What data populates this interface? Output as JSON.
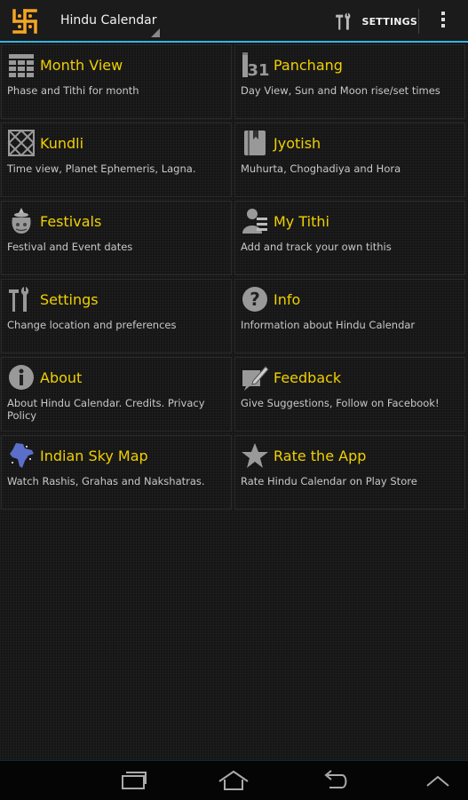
{
  "actionbar": {
    "title": "Hindu Calendar",
    "settings_label": "SETTINGS",
    "accent": "#33b5e5"
  },
  "menu": [
    {
      "title": "Month View",
      "desc": "Phase and Tithi for month",
      "icon": "calendar-grid-icon"
    },
    {
      "title": "Panchang",
      "desc": "Day View, Sun and Moon rise/set times",
      "icon": "calendar-31-icon",
      "icon_text": "31"
    },
    {
      "title": "Kundli",
      "desc": "Time view, Planet Ephemeris, Lagna.",
      "icon": "kundli-chart-icon"
    },
    {
      "title": "Jyotish",
      "desc": "Muhurta, Choghadiya and Hora",
      "icon": "book-icon"
    },
    {
      "title": "Festivals",
      "desc": "Festival and Event dates",
      "icon": "festival-pot-icon"
    },
    {
      "title": "My Tithi",
      "desc": "Add and track your own tithis",
      "icon": "person-list-icon"
    },
    {
      "title": "Settings",
      "desc": "Change location and preferences",
      "icon": "tools-icon"
    },
    {
      "title": "Info",
      "desc": "Information about Hindu Calendar",
      "icon": "question-icon"
    },
    {
      "title": "About",
      "desc": "About Hindu Calendar. Credits. Privacy Policy",
      "icon": "info-icon"
    },
    {
      "title": "Feedback",
      "desc": "Give Suggestions, Follow on Facebook!",
      "icon": "feedback-icon"
    },
    {
      "title": "Indian Sky Map",
      "desc": "Watch Rashis, Grahas and Nakshatras.",
      "icon": "india-map-icon"
    },
    {
      "title": "Rate the App",
      "desc": "Rate Hindu Calendar on Play Store",
      "icon": "star-icon"
    }
  ],
  "colors": {
    "title": "#f0d000",
    "logo": "#f5a623"
  }
}
